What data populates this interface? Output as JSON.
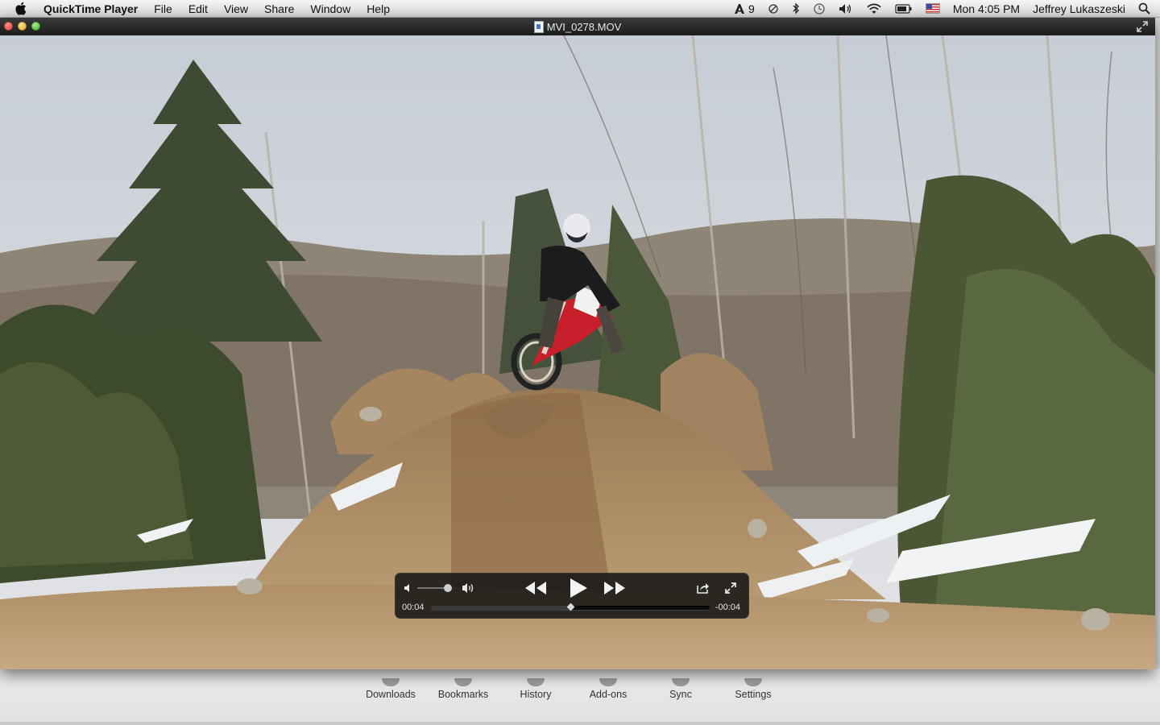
{
  "menubar": {
    "app_name": "QuickTime Player",
    "items": [
      "File",
      "Edit",
      "View",
      "Share",
      "Window",
      "Help"
    ],
    "adobe_badge": "9",
    "clock": "Mon 4:05 PM",
    "user": "Jeffrey Lukaszeski"
  },
  "player": {
    "window_title": "MVI_0278.MOV",
    "elapsed": "00:04",
    "remaining": "-00:04",
    "playback_fraction": 0.5,
    "volume_fraction": 0.95
  },
  "background_browser": {
    "toolbar": [
      "Downloads",
      "Bookmarks",
      "History",
      "Add-ons",
      "Sync",
      "Settings"
    ]
  }
}
